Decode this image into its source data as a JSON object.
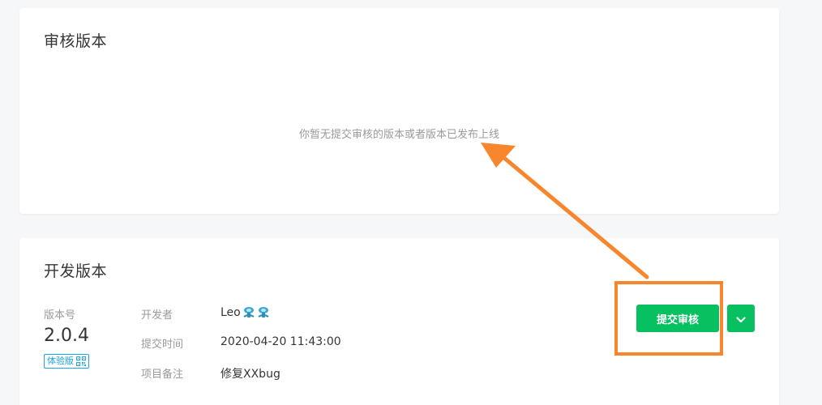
{
  "review_section": {
    "title": "审核版本",
    "empty_message": "你暂无提交审核的版本或者版本已发布上线"
  },
  "dev_section": {
    "title": "开发版本",
    "version_label": "版本号",
    "version_number": "2.0.4",
    "experience_badge": "体验版",
    "developer_label": "开发者",
    "developer_name": "Leo",
    "submit_time_label": "提交时间",
    "submit_time": "2020-04-20 11:43:00",
    "note_label": "项目备注",
    "note": "修复XXbug",
    "submit_button_label": "提交审核"
  },
  "colors": {
    "primary_green": "#07c160",
    "annotation_orange": "#f7862c",
    "badge_blue": "#1aa6e8"
  },
  "icons": {
    "badge_icon": "qr-code-icon",
    "developer_emoji": "emoji-icon",
    "more_button_icon": "chevron-down-icon"
  }
}
